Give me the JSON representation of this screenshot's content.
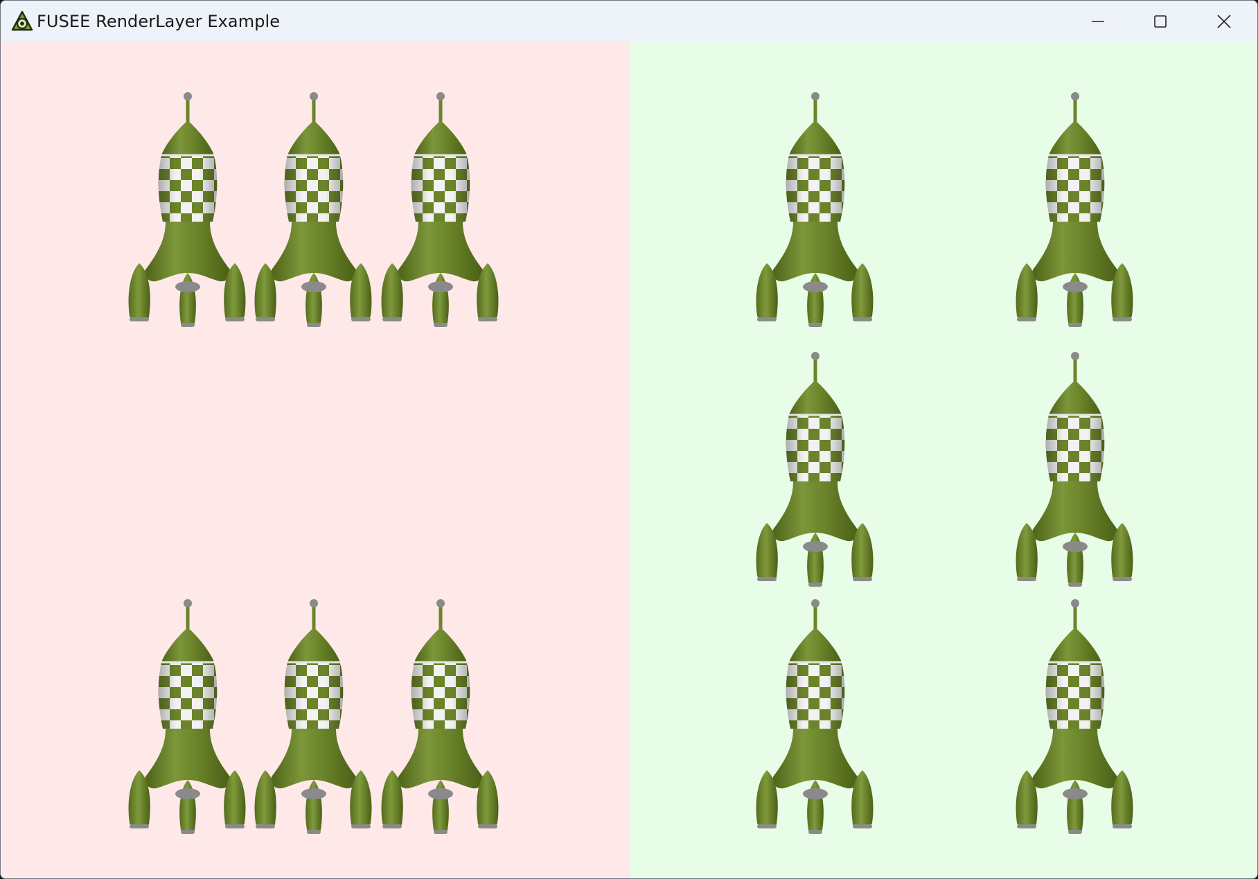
{
  "window": {
    "title": "FUSEE RenderLayer Example",
    "app_icon": "fusee-logo-icon",
    "controls": {
      "minimize": "minimize-icon",
      "maximize": "maximize-icon",
      "close": "close-icon"
    }
  },
  "viewports": {
    "left": {
      "background": "#fee8e8",
      "rocket_count": 6
    },
    "right": {
      "background": "#e7fde7",
      "rocket_count": 6
    }
  },
  "colors": {
    "rocket_body": "#6b842a",
    "rocket_dark": "#4d6317",
    "rocket_light": "#8ea34a",
    "checker_white": "#f2f2f2",
    "metal_grey": "#8a8a8a"
  }
}
